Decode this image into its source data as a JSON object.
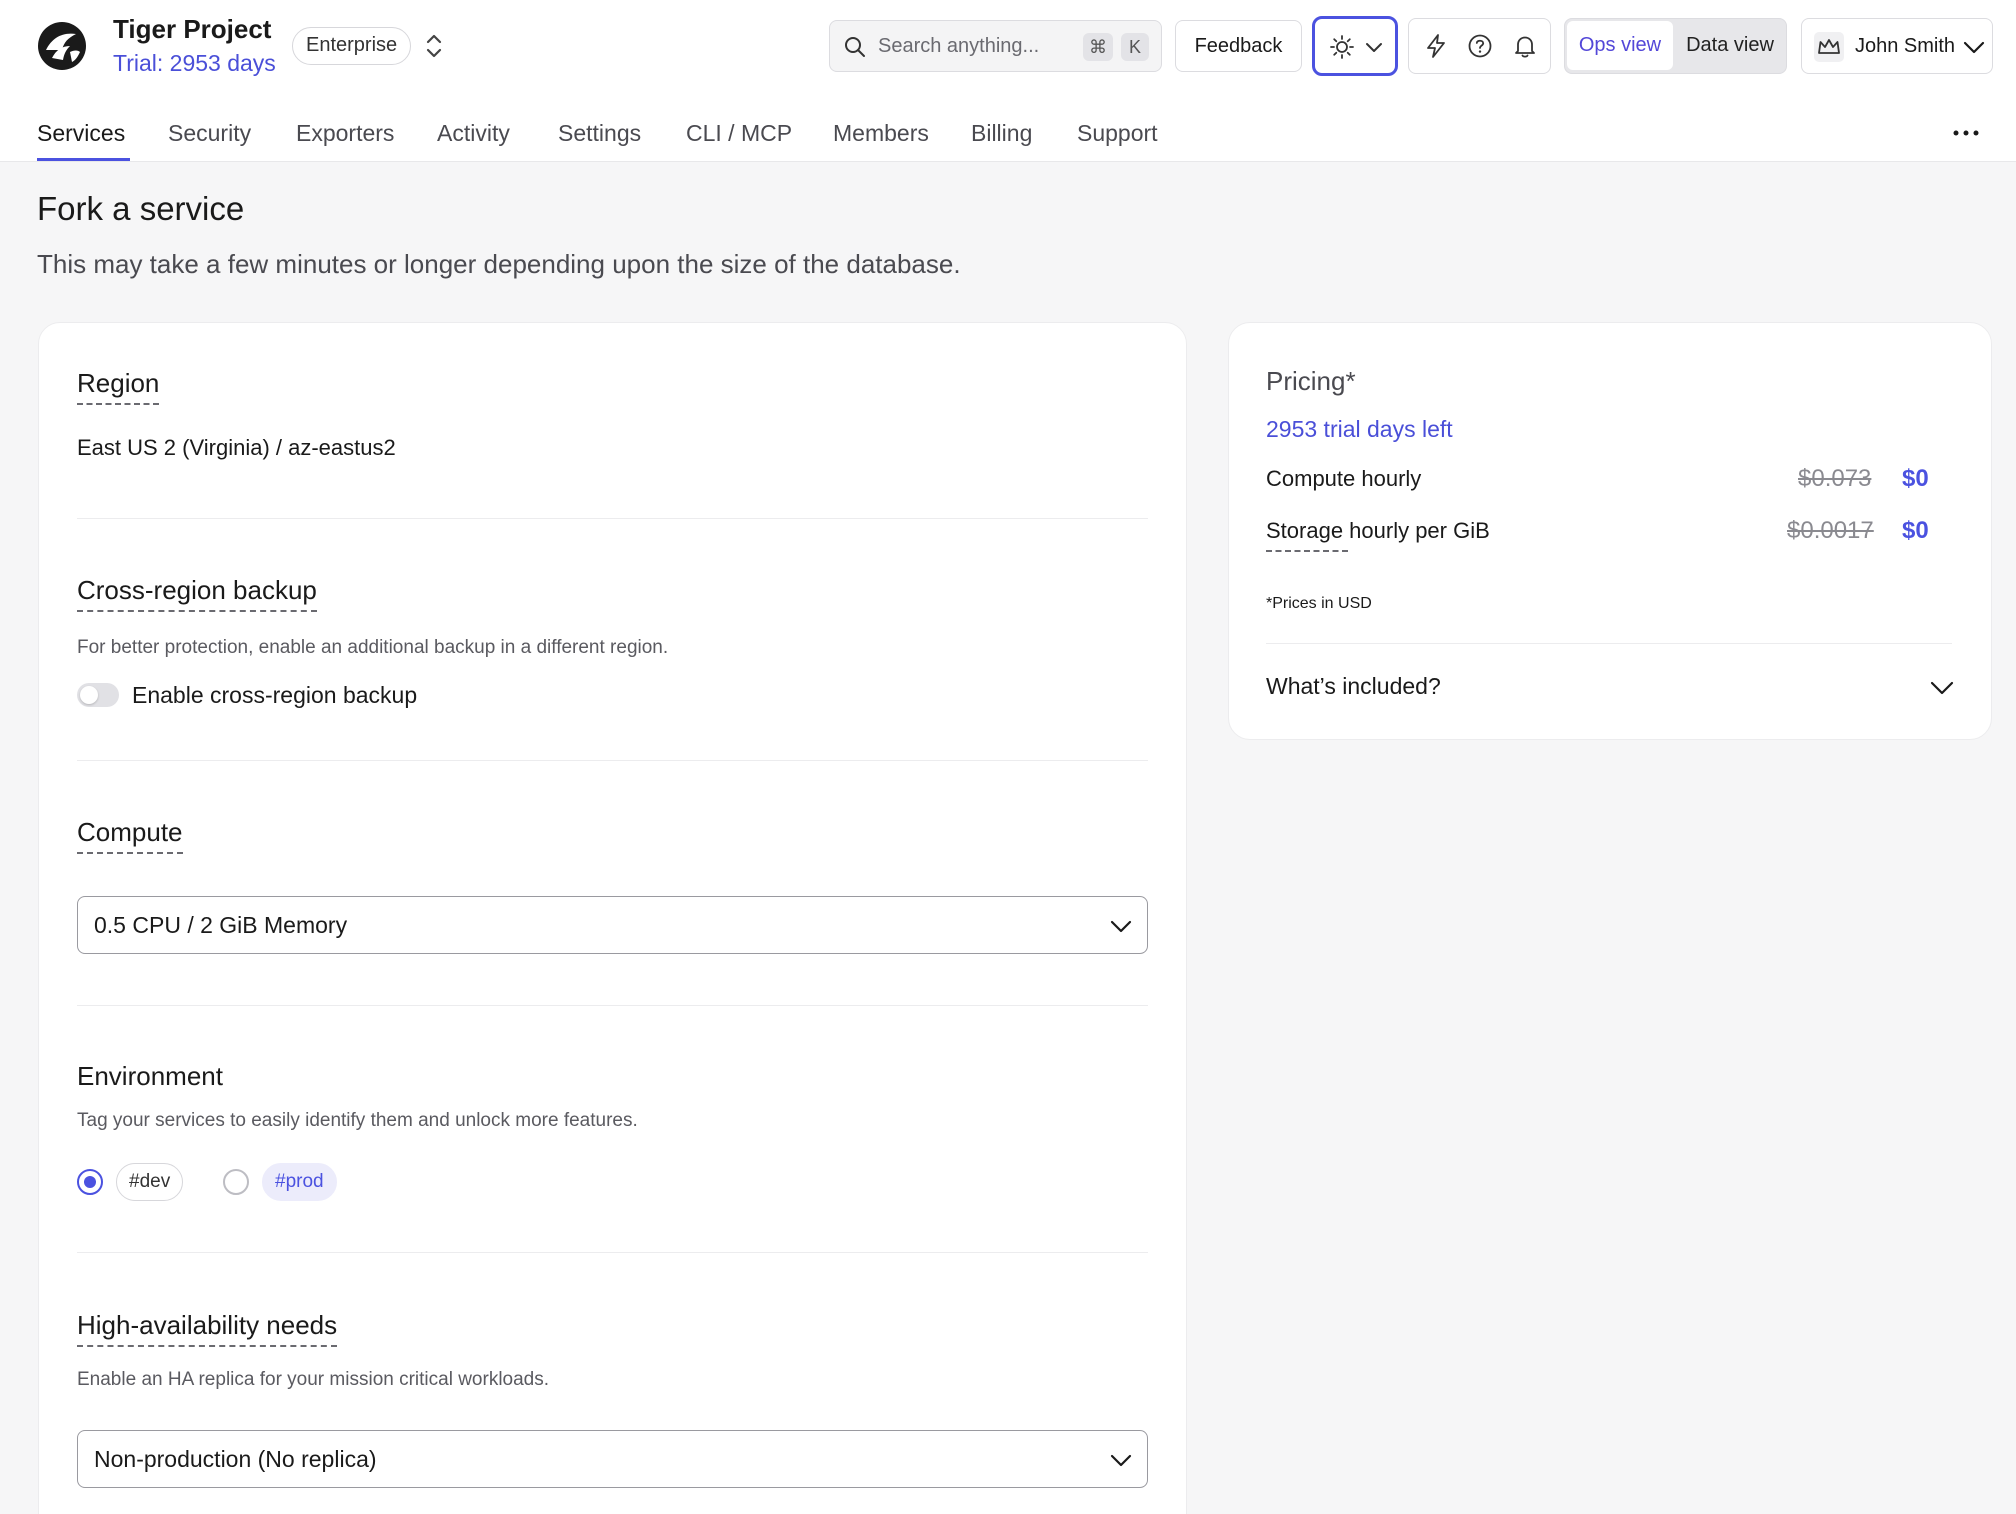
{
  "header": {
    "project_name": "Tiger Project",
    "trial_label": "Trial: 2953 days",
    "tier": "Enterprise",
    "search_placeholder": "Search anything...",
    "search_keys": [
      "⌘",
      "K"
    ],
    "feedback_label": "Feedback",
    "view_ops": "Ops view",
    "view_data": "Data view",
    "user_name": "John Smith"
  },
  "tabs": [
    {
      "label": "Services",
      "active": true
    },
    {
      "label": "Security"
    },
    {
      "label": "Exporters"
    },
    {
      "label": "Activity"
    },
    {
      "label": "Settings"
    },
    {
      "label": "CLI / MCP"
    },
    {
      "label": "Members"
    },
    {
      "label": "Billing"
    },
    {
      "label": "Support"
    }
  ],
  "page": {
    "title": "Fork a service",
    "subtitle": "This may take a few minutes or longer depending upon the size of the database."
  },
  "form": {
    "region": {
      "title": "Region",
      "value": "East US 2 (Virginia) / az-eastus2"
    },
    "backup": {
      "title": "Cross-region backup",
      "description": "For better protection, enable an additional backup in a different region.",
      "toggle_label": "Enable cross-region backup",
      "enabled": false
    },
    "compute": {
      "title": "Compute",
      "selected": "0.5 CPU / 2 GiB Memory"
    },
    "environment": {
      "title": "Environment",
      "description": "Tag your services to easily identify them and unlock more features.",
      "options": [
        "#dev",
        "#prod"
      ],
      "selected": "#dev"
    },
    "ha": {
      "title": "High-availability needs",
      "description": "Enable an HA replica for your mission critical workloads.",
      "selected": "Non-production (No replica)"
    }
  },
  "pricing": {
    "title": "Pricing*",
    "trial_left": "2953 trial days left",
    "compute_label": "Compute hourly",
    "compute_old": "$0.073",
    "compute_new": "$0",
    "storage_label": "Storage hourly per GiB",
    "storage_old": "$0.0017",
    "storage_new": "$0",
    "note": "*Prices in USD",
    "included": "What’s included?"
  },
  "colors": {
    "accent": "#4b52e0",
    "link": "#4a4fd8"
  }
}
